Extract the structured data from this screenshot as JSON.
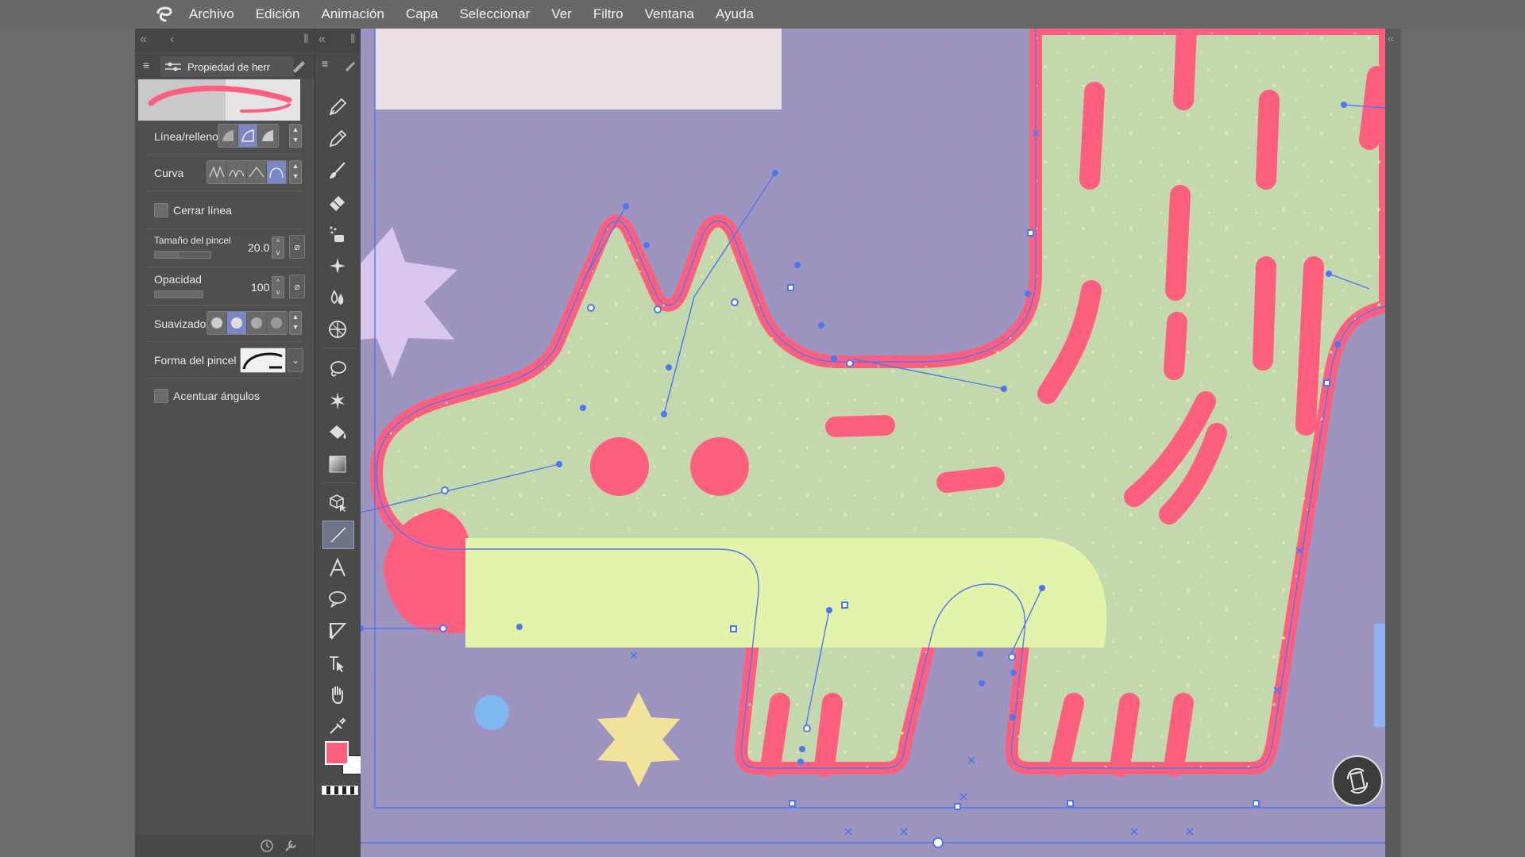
{
  "menu": {
    "items": [
      "Archivo",
      "Edición",
      "Animación",
      "Capa",
      "Seleccionar",
      "Ver",
      "Filtro",
      "Ventana",
      "Ayuda"
    ]
  },
  "tool_property": {
    "tab_label": "Propiedad de herr",
    "rows": {
      "line_fill": {
        "label": "Línea/relleno"
      },
      "curve": {
        "label": "Curva"
      },
      "close_line": {
        "label": "Cerrar línea",
        "checked": false
      },
      "brush_size": {
        "label": "Tamaño del pincel",
        "value": "20.0"
      },
      "opacity": {
        "label": "Opacidad",
        "value": "100"
      },
      "smoothing": {
        "label": "Suavizado"
      },
      "brush_shape": {
        "label": "Forma del pincel"
      },
      "corners": {
        "label": "Acentuar ángulos",
        "checked": false
      }
    }
  },
  "colors": {
    "main_color": "#ff5f7e",
    "sub_color": "#ffffff",
    "canvas_bg": "#9d94c0",
    "body_fill": "#c4d8ad",
    "outline": "#ff5f7e",
    "vector_line": "#4f76ee"
  },
  "tools": [
    "pen-icon",
    "pencil-icon",
    "brush-icon",
    "eraser-icon",
    "decoration-icon",
    "airbrush-icon",
    "blend-icon",
    "perspective-icon",
    "lasso-icon",
    "auto-select-icon",
    "fill-icon",
    "gradient-icon",
    "3d-icon",
    "figure-line-icon",
    "text-icon",
    "balloon-icon",
    "frame-border-icon",
    "ruler-icon",
    "hand-icon",
    "eyedropper-icon"
  ]
}
